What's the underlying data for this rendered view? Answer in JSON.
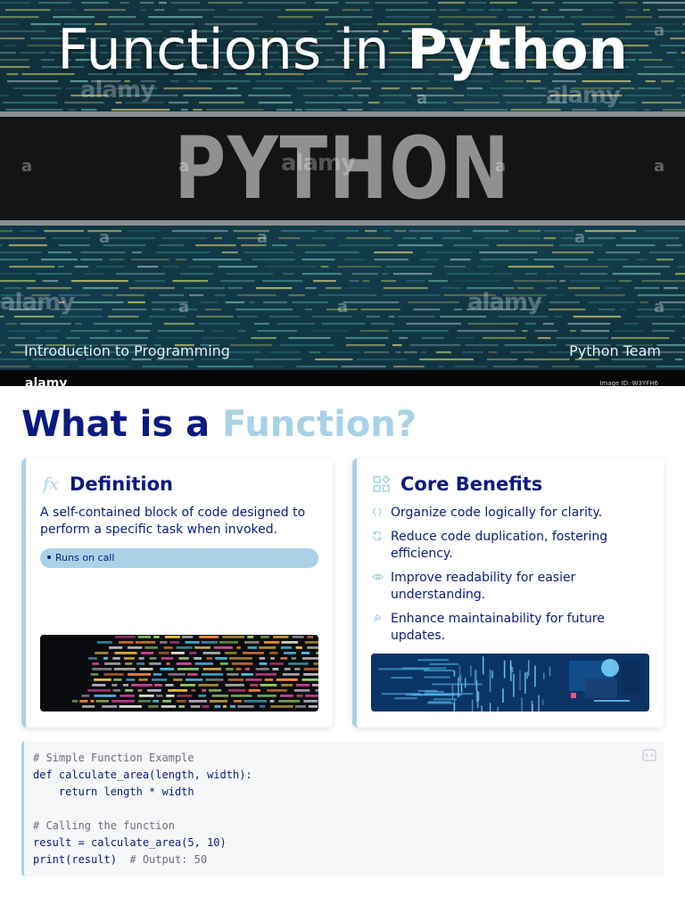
{
  "hero": {
    "title_regular": "Functions in ",
    "title_bold": "Python",
    "banner_text": "PYTHON",
    "watermark_text": "alamy",
    "watermark_letter": "a",
    "subtitle": "Introduction to Programming",
    "team": "Python Team",
    "strip_logo": "alamy",
    "strip_id": "Image ID: W3YFH6"
  },
  "main": {
    "heading_part1": "What is a ",
    "heading_part2": "Function?"
  },
  "definition": {
    "title": "Definition",
    "icon": "fx-icon",
    "text": "A self-contained block of code designed to perform a specific task when invoked.",
    "pill": "Runs on call"
  },
  "benefits": {
    "title": "Core Benefits",
    "icon": "shapes-icon",
    "items": [
      {
        "icon": "code-brackets-icon",
        "text": "Organize code logically for clarity."
      },
      {
        "icon": "recycle-icon",
        "text": "Reduce code duplication, fostering efficiency."
      },
      {
        "icon": "eye-icon",
        "text": "Improve readability for easier understanding."
      },
      {
        "icon": "wrench-icon",
        "text": "Enhance maintainability for future updates."
      }
    ]
  },
  "code": {
    "lines": [
      {
        "kind": "comment",
        "text": "# Simple Function Example"
      },
      {
        "kind": "code",
        "text": "def calculate_area(length, width):"
      },
      {
        "kind": "code",
        "text": "    return length * width"
      },
      {
        "kind": "blank",
        "text": ""
      },
      {
        "kind": "comment",
        "text": "# Calling the function"
      },
      {
        "kind": "code",
        "text": "result = calculate_area(5, 10)"
      },
      {
        "kind": "mixed",
        "text": "print(result)",
        "comment": "  # Output: 50"
      }
    ]
  },
  "colors": {
    "navy": "#0a1a80",
    "accent": "#a9d2e6",
    "banner": "#121416",
    "code_bg": "#f6f7f9"
  }
}
